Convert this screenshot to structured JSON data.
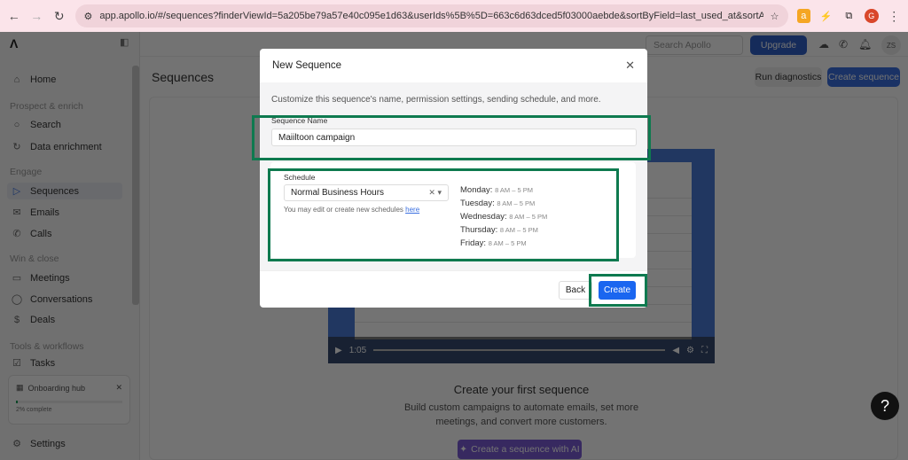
{
  "browser": {
    "url": "app.apollo.io/#/sequences?finderViewId=5a205be79a57e40c095e1d63&userIds%5B%5D=663c6d63dced5f03000aebde&sortByField=last_used_at&sortAscending=false&guidedEmai...",
    "profile_initial": "G"
  },
  "sidebar": {
    "home": "Home",
    "sec_prospect": "Prospect & enrich",
    "search": "Search",
    "data_enrichment": "Data enrichment",
    "sec_engage": "Engage",
    "sequences": "Sequences",
    "emails": "Emails",
    "calls": "Calls",
    "sec_win": "Win & close",
    "meetings": "Meetings",
    "conversations": "Conversations",
    "deals": "Deals",
    "sec_tools": "Tools & workflows",
    "tasks": "Tasks",
    "onboarding": {
      "title": "Onboarding hub",
      "progress_label": "2% complete",
      "progress": 2
    },
    "settings": "Settings"
  },
  "header": {
    "search_placeholder": "Search Apollo",
    "upgrade": "Upgrade",
    "avatar": "ZS"
  },
  "page": {
    "title": "Sequences",
    "run_diagnostics": "Run diagnostics",
    "create_sequence": "Create sequence",
    "video_time": "1:05",
    "empty_title": "Create your first sequence",
    "empty_sub": "Build custom campaigns to automate emails, set more meetings, and convert more customers.",
    "ai_button": "Create a sequence with AI"
  },
  "modal": {
    "title": "New Sequence",
    "description": "Customize this sequence's name, permission settings, sending schedule, and more.",
    "name_label": "Sequence Name",
    "name_value": "Maiiltoon campaign",
    "schedule_label": "Schedule",
    "schedule_value": "Normal Business Hours",
    "schedule_note": "You may edit or create new schedules ",
    "schedule_link": "here",
    "days": [
      {
        "day": "Monday:",
        "time": "8 AM – 5 PM"
      },
      {
        "day": "Tuesday:",
        "time": "8 AM – 5 PM"
      },
      {
        "day": "Wednesday:",
        "time": "8 AM – 5 PM"
      },
      {
        "day": "Thursday:",
        "time": "8 AM – 5 PM"
      },
      {
        "day": "Friday:",
        "time": "8 AM – 5 PM"
      }
    ],
    "back": "Back",
    "create": "Create"
  },
  "colors": {
    "highlight": "#0e7a4f",
    "primary": "#1a66f0"
  }
}
